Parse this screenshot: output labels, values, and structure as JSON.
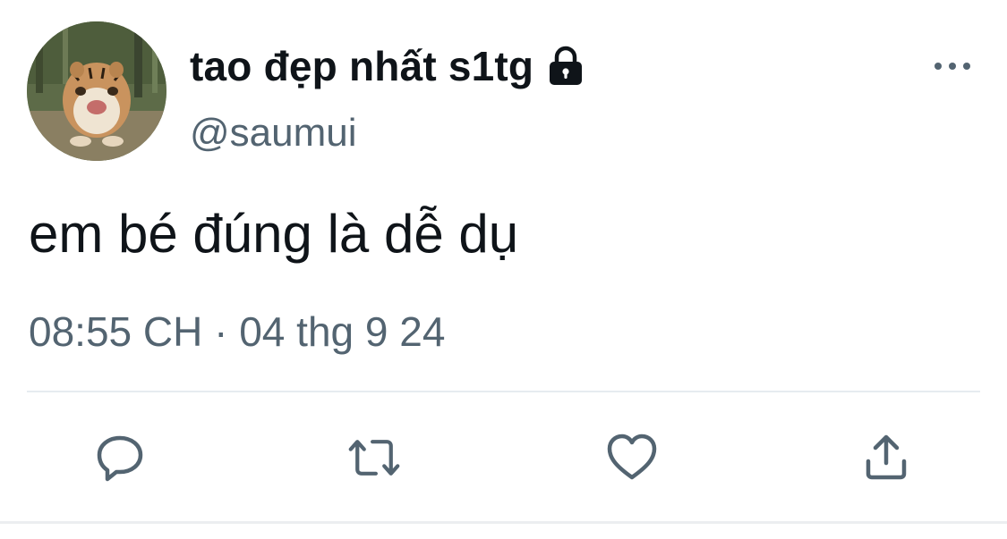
{
  "tweet": {
    "display_name": "tao đẹp nhất s1tg",
    "handle": "@saumui",
    "text": "em bé đúng là dễ dụ",
    "timestamp": "08:55 CH · 04 thg 9 24"
  },
  "icons": {
    "lock": "lock-icon",
    "more": "more-horizontal-icon",
    "reply": "reply-icon",
    "retweet": "retweet-icon",
    "like": "heart-icon",
    "share": "share-icon"
  },
  "colors": {
    "text_primary": "#0f1419",
    "text_secondary": "#536471",
    "icon": "#536471",
    "divider": "#e6ecf0"
  }
}
